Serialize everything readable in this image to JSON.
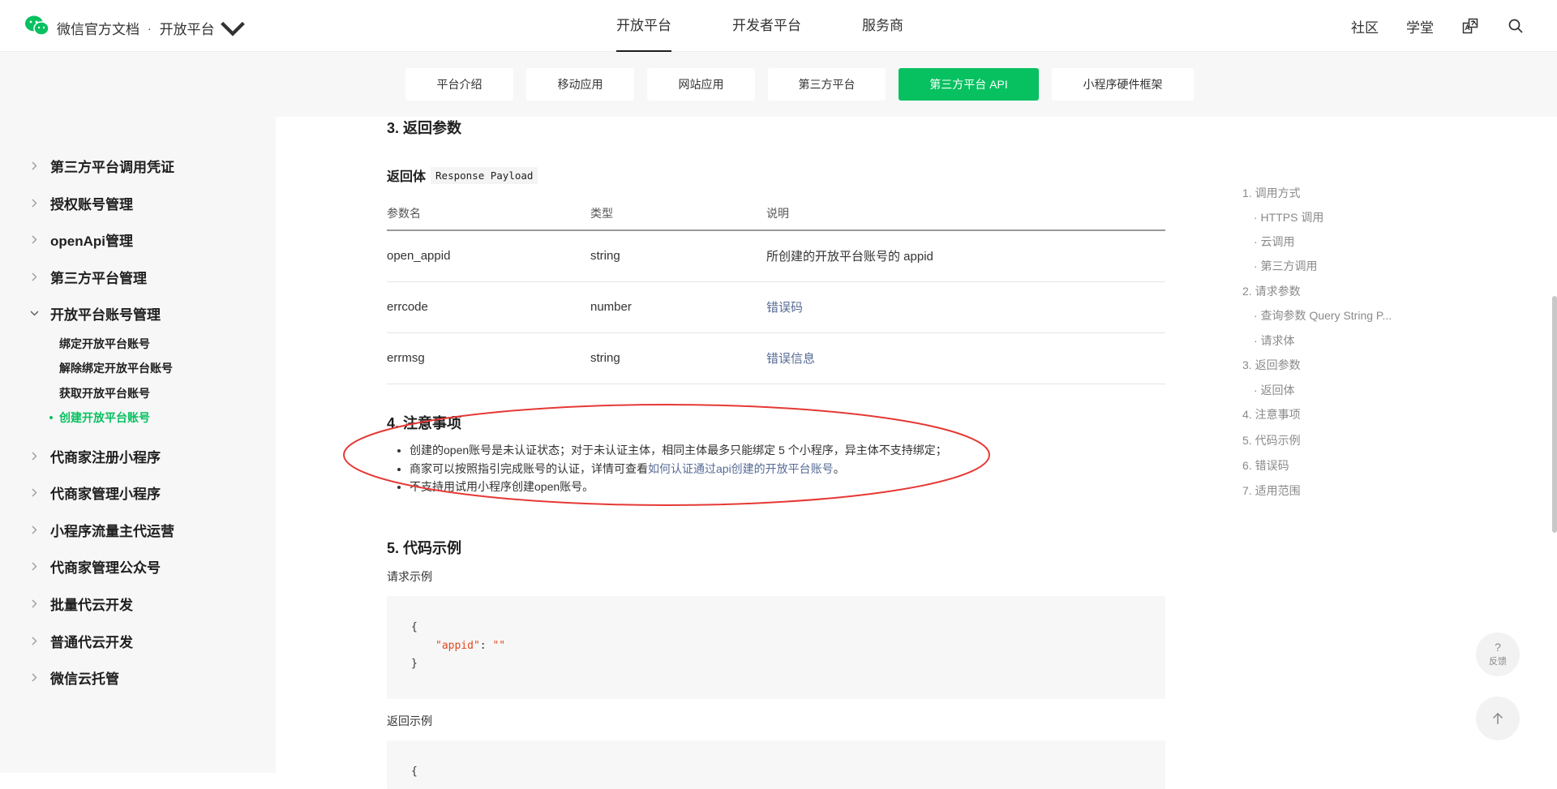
{
  "header": {
    "brand": "微信官方文档",
    "dot": "·",
    "platform": "开放平台",
    "nav": [
      "开放平台",
      "开发者平台",
      "服务商"
    ],
    "right": {
      "community": "社区",
      "academy": "学堂"
    }
  },
  "subtabs": [
    "平台介绍",
    "移动应用",
    "网站应用",
    "第三方平台",
    "第三方平台 API",
    "小程序硬件框架"
  ],
  "sidebar": {
    "items": [
      "第三方平台调用凭证",
      "授权账号管理",
      "openApi管理",
      "第三方平台管理",
      "开放平台账号管理"
    ],
    "sub_items": [
      "绑定开放平台账号",
      "解除绑定开放平台账号",
      "获取开放平台账号",
      "创建开放平台账号"
    ],
    "items_after": [
      "代商家注册小程序",
      "代商家管理小程序",
      "小程序流量主代运营",
      "代商家管理公众号",
      "批量代云开发",
      "普通代云开发",
      "微信云托管"
    ]
  },
  "content": {
    "sec3_title": "3. 返回参数",
    "payload_label": "返回体",
    "payload_code": "Response Payload",
    "table_headers": [
      "参数名",
      "类型",
      "说明"
    ],
    "rows": [
      {
        "name": "open_appid",
        "type": "string",
        "desc": "所创建的开放平台账号的 appid"
      },
      {
        "name": "errcode",
        "type": "number",
        "desc": "错误码"
      },
      {
        "name": "errmsg",
        "type": "string",
        "desc": "错误信息"
      }
    ],
    "sec4_title": "4. 注意事项",
    "notes": [
      "创建的open账号是未认证状态；对于未认证主体，相同主体最多只能绑定 5 个小程序，异主体不支持绑定；",
      "商家可以按照指引完成账号的认证，详情可查看",
      "不支持用试用小程序创建open账号。"
    ],
    "note2_link": "如何认证通过api创建的开放平台账号",
    "note2_end": "。",
    "sec5_title": "5. 代码示例",
    "req_label": "请求示例",
    "code_open": "{",
    "code_key": "\"appid\"",
    "code_colon": ": ",
    "code_val": "\"\"",
    "code_close": "}",
    "resp_label": "返回示例",
    "resp_code_start": "{"
  },
  "toc": [
    "1. 调用方式",
    "· HTTPS 调用",
    "· 云调用",
    "· 第三方调用",
    "2. 请求参数",
    "· 查询参数 Query String P...",
    "· 请求体",
    "3. 返回参数",
    "· 返回体",
    "4. 注意事项",
    "5. 代码示例",
    "6. 错误码",
    "7. 适用范围"
  ],
  "fab": {
    "question": "?",
    "feedback": "反馈"
  },
  "colors": {
    "accent": "#07c160",
    "link": "#576b95",
    "annotation": "#e53935"
  }
}
